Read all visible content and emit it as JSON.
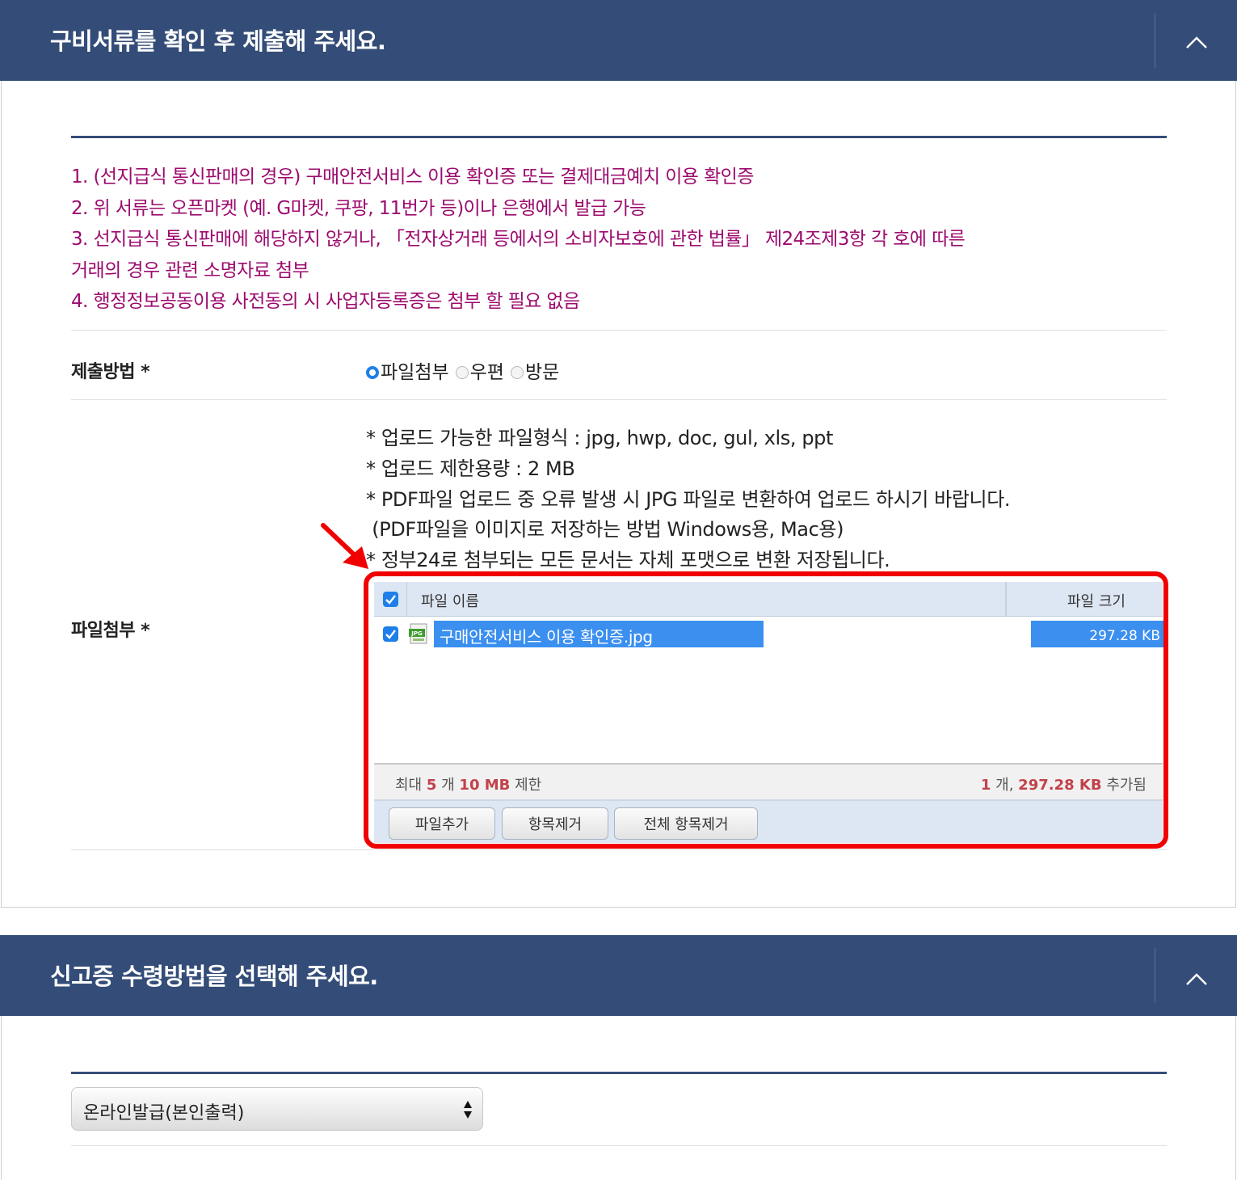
{
  "section1": {
    "title": "구비서류를 확인 후 제출해 주세요.",
    "toggle_icon": "chevron-up-icon",
    "notice": [
      "1. (선지급식 통신판매의 경우) 구매안전서비스 이용 확인증 또는 결제대금예치 이용 확인증",
      "2. 위 서류는 오픈마켓 (예. G마켓, 쿠팡, 11번가 등)이나 은행에서 발급 가능",
      "3. 선지급식 통신판매에 해당하지 않거나, 「전자상거래 등에서의 소비자보호에 관한 법률」 제24조제3항 각 호에 따른",
      "거래의 경우 관련 소명자료 첨부",
      "4. 행정정보공동이용 사전동의 시 사업자등록증은 첨부 할 필요 없음"
    ],
    "submit_method": {
      "label": "제출방법 *",
      "options": [
        "파일첨부",
        "우편",
        "방문"
      ],
      "selected": "파일첨부"
    },
    "attachment": {
      "label": "파일첨부 *",
      "info": [
        "* 업로드 가능한 파일형식 : jpg, hwp, doc, gul, xls, ppt",
        "* 업로드 제한용량 : 2 MB",
        "* PDF파일 업로드 중 오류 발생 시 JPG 파일로 변환하여 업로드 하시기 바랍니다.",
        " (PDF파일을 이미지로 저장하는 방법 Windows용, Mac용)",
        "* 정부24로 첨부되는 모든 문서는 자체 포맷으로 변환 저장됩니다."
      ],
      "table": {
        "col_name": "파일 이름",
        "col_size": "파일 크기",
        "files": [
          {
            "name": "구매안전서비스 이용 확인증.jpg",
            "size": "297.28 KB",
            "icon": "jpg-file-icon",
            "checked": true
          }
        ]
      },
      "limits": {
        "prefix": "최대",
        "max_count": "5",
        "count_unit": "개",
        "max_size": "10 MB",
        "suffix": "제한"
      },
      "added": {
        "count": "1",
        "count_unit": "개,",
        "size": "297.28 KB",
        "suffix": "추가됨"
      },
      "buttons": {
        "add": "파일추가",
        "remove": "항목제거",
        "remove_all": "전체 항목제거"
      }
    }
  },
  "section2": {
    "title": "신고증 수령방법을 선택해 주세요.",
    "toggle_icon": "chevron-up-icon",
    "select_value": "온라인발급(본인출력)"
  },
  "colors": {
    "header_bg": "#344d78",
    "notice_text": "#9c0b6e",
    "highlight_border": "#f00000",
    "selection_bg": "#3b8fef",
    "accent_blue": "#1f7fe8",
    "count_red": "#c2424a"
  }
}
